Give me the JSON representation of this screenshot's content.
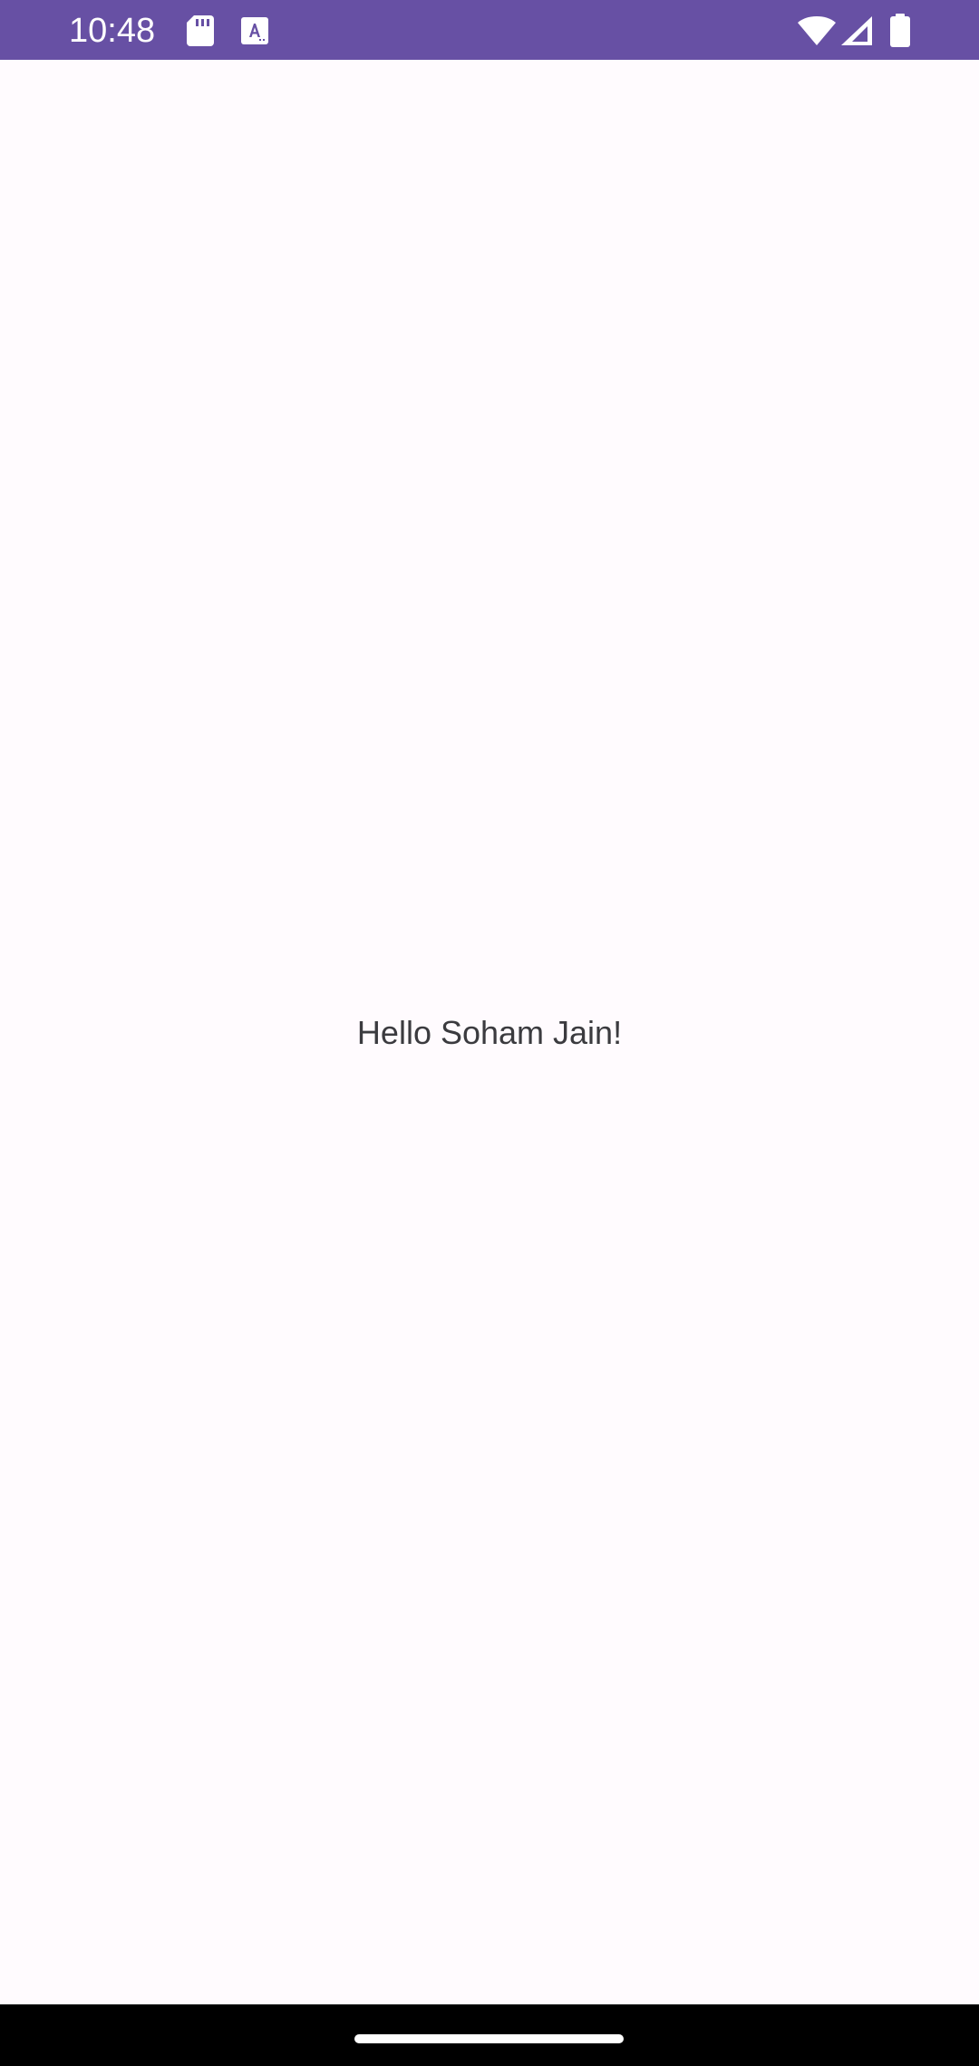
{
  "status_bar": {
    "time": "10:48",
    "background_color": "#6750a4",
    "icons": [
      "sd-card-icon",
      "text-a-icon",
      "wifi-icon",
      "cell-signal-icon",
      "battery-icon"
    ]
  },
  "main": {
    "greeting": "Hello Soham Jain!",
    "background_color": "#fffbfe",
    "text_color": "#3b3b3f"
  },
  "navigation_bar": {
    "background_color": "#000000",
    "handle_color": "#ffffff",
    "handle_icon": "home-gesture-handle"
  }
}
